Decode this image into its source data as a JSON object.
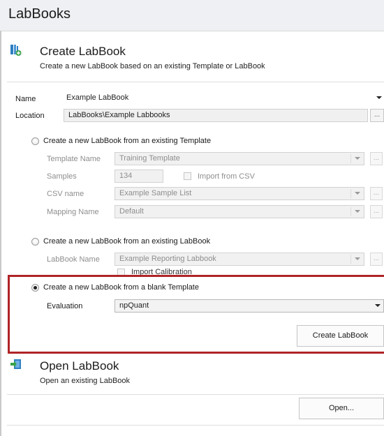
{
  "app": {
    "title": "LabBooks"
  },
  "create_section": {
    "title": "Create LabBook",
    "subtitle": "Create a new LabBook based on an existing Template or LabBook",
    "name_label": "Name",
    "name_value": "Example LabBook",
    "location_label": "Location",
    "location_value": "LabBooks\\Example Labbooks",
    "browse_label": "..."
  },
  "option_template": {
    "radio_label": "Create a new LabBook from an existing Template",
    "selected": false,
    "template_name_label": "Template Name",
    "template_name_value": "Training Template",
    "samples_label": "Samples",
    "samples_value": "134",
    "import_csv_label": "Import from CSV",
    "csv_name_label": "CSV name",
    "csv_name_value": "Example Sample List",
    "mapping_name_label": "Mapping Name",
    "mapping_name_value": "Default",
    "browse_label": "..."
  },
  "option_labbook": {
    "radio_label": "Create a new LabBook from an existing LabBook",
    "selected": false,
    "labbook_name_label": "LabBook Name",
    "labbook_name_value": "Example Reporting Labbook",
    "import_calibration_label": "Import Calibration",
    "browse_label": "..."
  },
  "option_blank": {
    "radio_label": "Create a new LabBook from a blank Template",
    "selected": true,
    "evaluation_label": "Evaluation",
    "evaluation_value": "npQuant",
    "create_button": "Create LabBook"
  },
  "open_section": {
    "title": "Open LabBook",
    "subtitle": "Open an existing LabBook",
    "open_button": "Open..."
  },
  "colors": {
    "highlight": "#b02427",
    "accent_icon": "#2f7fc3",
    "icon_green": "#3aa24a"
  }
}
